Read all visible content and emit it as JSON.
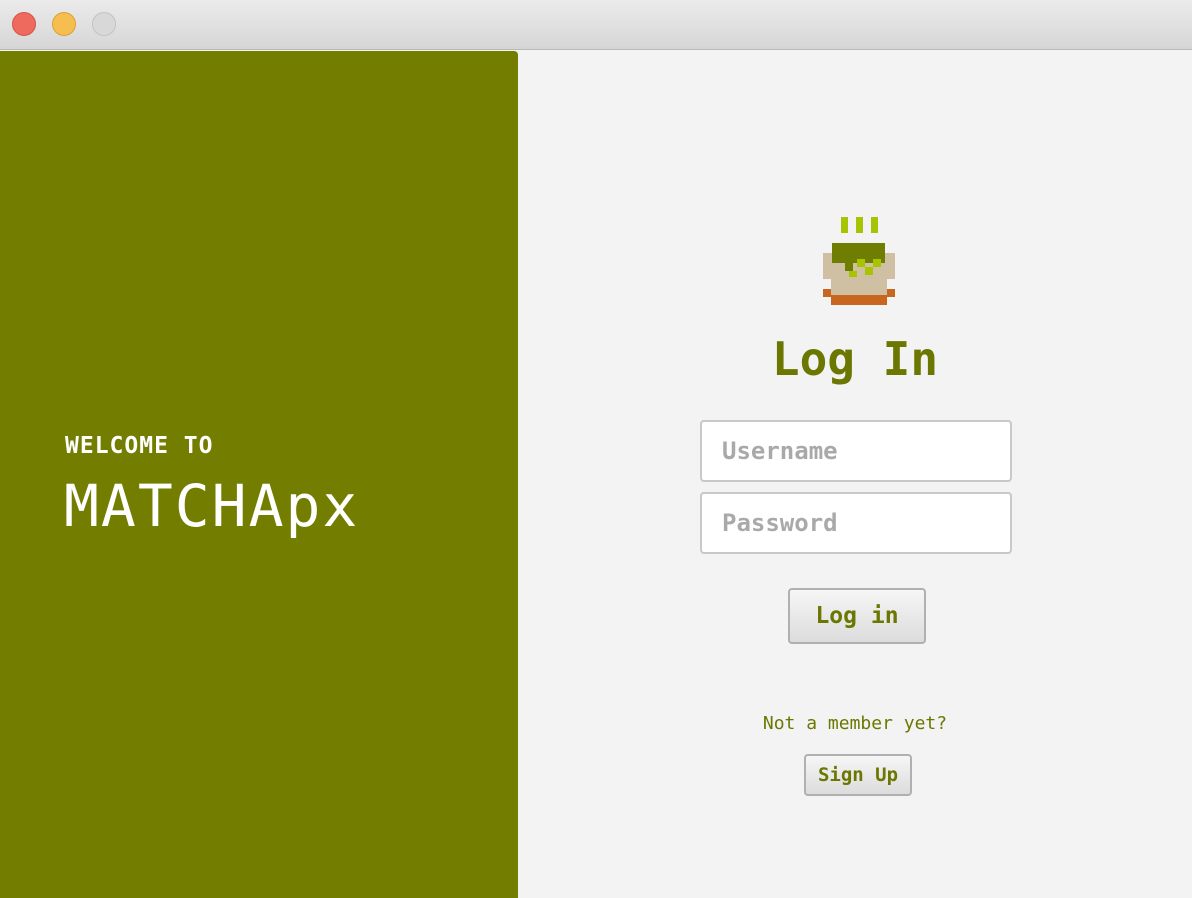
{
  "window": {
    "controls": [
      "close-button",
      "minimize-button",
      "zoom-button"
    ]
  },
  "left": {
    "welcome": "WELCOME TO",
    "brand": "MATCHApx",
    "background_color": "#737d00"
  },
  "right": {
    "logo_icon": "matcha-cup-icon",
    "title": "Log In",
    "username_placeholder": "Username",
    "password_placeholder": "Password",
    "login_label": "Log in",
    "signup_prompt": "Not a member yet?",
    "signup_label": "Sign Up",
    "accent_color": "#6b7700"
  }
}
